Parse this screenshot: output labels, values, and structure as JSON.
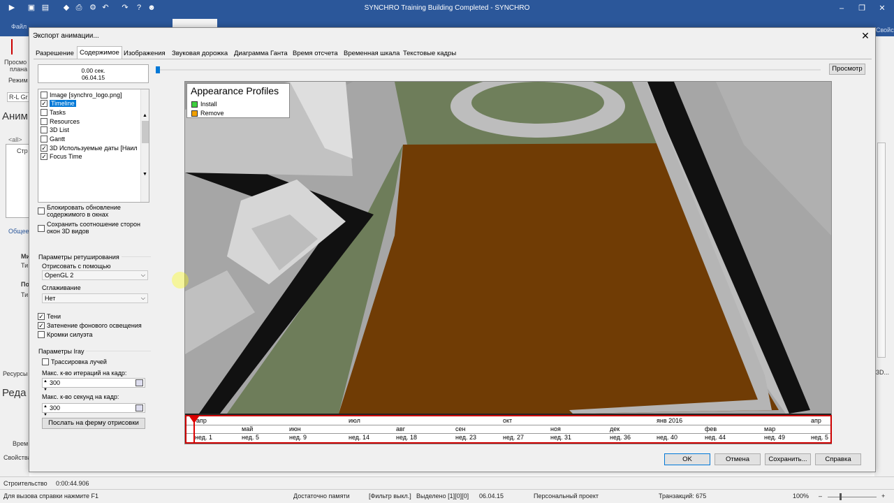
{
  "app": {
    "title": "SYNCHRO Training Building Completed - SYNCHRO"
  },
  "ribbon": {
    "file": "Файл"
  },
  "background": {
    "left_labels": [
      "Просмо",
      "плана",
      "Режим",
      "R-L Gr",
      "Аним",
      "<all>",
      "Стр",
      "Общее",
      "Ми",
      "Ти",
      "По",
      "Ти",
      "Ресурсы",
      "Реда",
      "Врем",
      "Свойства"
    ],
    "right_labels": [
      "Свойства",
      "3D..."
    ]
  },
  "dialog": {
    "title": "Экспорт анимации...",
    "tabs": [
      "Разрешение",
      "Содержимое",
      "Изображения",
      "Звуковая дорожка",
      "Диаграмма Ганта",
      "Время отсчета",
      "Временная шкала",
      "Текстовые кадры"
    ],
    "active_tab": "Содержимое",
    "time_sec": "0.00 сек.",
    "time_date": "06.04.15",
    "preview_button": "Просмотр",
    "content_items": [
      {
        "label": "Image [synchro_logo.png]",
        "checked": false
      },
      {
        "label": "Timeline",
        "checked": true,
        "selected": true
      },
      {
        "label": "Tasks",
        "checked": false
      },
      {
        "label": "Resources",
        "checked": false
      },
      {
        "label": "3D List",
        "checked": false
      },
      {
        "label": "Gantt",
        "checked": false
      },
      {
        "label": "3D Используемые даты [Наил",
        "checked": true
      },
      {
        "label": "Focus Time",
        "checked": true
      }
    ],
    "block_update": "Блокировать обновление содержимого в окнах",
    "keep_aspect": "Сохранить соотношение сторон окон 3D видов",
    "render_params": "Параметры ретуширования",
    "render_with": "Отрисовать с помощью",
    "render_value": "OpenGL 2",
    "smoothing": "Сглаживание",
    "smoothing_value": "Нет",
    "shadows": "Тени",
    "ambient": "Затенение фонового освещения",
    "silhouette": "Кромки силуэта",
    "iray_params": "Параметры Iray",
    "ray_trace": "Трассировка лучей",
    "max_iter": "Макс. к-во итераций на кадр:",
    "max_iter_value": "300",
    "max_sec": "Макс. к-во секунд на кадр:",
    "max_sec_value": "300",
    "farm_button": "Послать на ферму отрисовки",
    "ok": "OK",
    "cancel": "Отмена",
    "save": "Сохранить...",
    "help": "Справка"
  },
  "viewport": {
    "legend_title": "Appearance Profiles",
    "legend": [
      {
        "label": "Install",
        "color": "#3fcf3f"
      },
      {
        "label": "Remove",
        "color": "#f0a000"
      }
    ]
  },
  "timeline": {
    "months_row1": [
      "апр",
      "июл",
      "окт",
      "янв 2016",
      "апр"
    ],
    "months_row2": [
      "май",
      "июн",
      "авг",
      "сен",
      "ноя",
      "дек",
      "фев",
      "мар"
    ],
    "weeks": [
      "нед. 1",
      "нед. 5",
      "нед. 9",
      "нед. 14",
      "нед. 18",
      "нед. 23",
      "нед. 27",
      "нед. 31",
      "нед. 36",
      "нед. 40",
      "нед. 44",
      "нед. 49",
      "нед. 5"
    ]
  },
  "status": {
    "mode": "Строительство",
    "elapsed": "0:00:44.906",
    "help": "Для вызова справки нажмите F1",
    "memory": "Достаточно памяти",
    "filter": "[Фильтр выкл.]",
    "selected": "Выделено [1][0][0]",
    "date": "06.04.15",
    "project": "Персональный проект",
    "transactions": "Транзакций: 675",
    "zoom": "100%"
  }
}
